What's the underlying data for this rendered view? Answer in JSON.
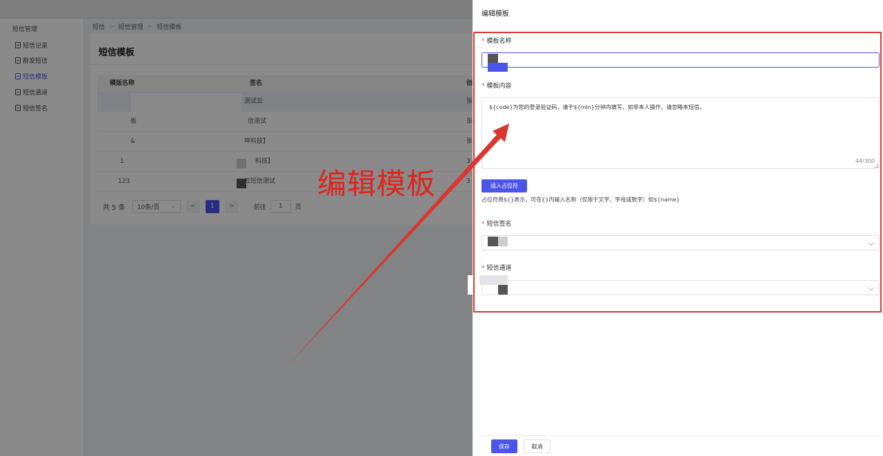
{
  "sidebar": {
    "group_title": "短信管理",
    "items": [
      {
        "label": "短信记录"
      },
      {
        "label": "群发短信"
      },
      {
        "label": "短信模板"
      },
      {
        "label": "短信通道"
      },
      {
        "label": "短信签名"
      }
    ]
  },
  "breadcrumb": [
    "短信",
    "短信管理",
    "短信模板"
  ],
  "page": {
    "title": "短信模板"
  },
  "table": {
    "columns": [
      "模版名称",
      "签名",
      "创"
    ],
    "rows": [
      {
        "name": "",
        "signature": "测试云",
        "extra": "张"
      },
      {
        "name": "板",
        "signature": "信测试",
        "extra": "张"
      },
      {
        "name": "&",
        "signature": "坤科技】",
        "extra": "张"
      },
      {
        "name": "1",
        "signature": "科技】",
        "extra": "3"
      },
      {
        "name": "123",
        "signature": "云短信测试",
        "extra": "3"
      }
    ]
  },
  "pagination": {
    "total": "共 5 条",
    "page_size": "10条/页",
    "prev": "<",
    "current": "1",
    "next": ">",
    "goto_label": "前往",
    "goto_value": "1",
    "goto_suffix": "页"
  },
  "annotation": {
    "text": "编辑模板",
    "color": "#e0231c"
  },
  "drawer": {
    "title": "编辑模板",
    "fields": {
      "name": {
        "label": "模板名称",
        "required": "*"
      },
      "content": {
        "label": "模板内容",
        "required": "*",
        "value": "${code}为您的登录验证码，请于${min}分钟内填写，如非本人操作，请忽略本短信。",
        "counter": "44/300"
      },
      "signature": {
        "label": "短信签名",
        "required": "*"
      },
      "channel": {
        "label": "短信通道",
        "required": "*"
      }
    },
    "insert_button": "插入占位符",
    "hint": "占位符用${}表示，可在{}内输入名称（仅限于文字、字母或数字）如${name}",
    "save_button": "保存",
    "cancel_button": "取消"
  },
  "colors": {
    "primary": "#4b55e8",
    "annotation_red": "#d9372f"
  }
}
